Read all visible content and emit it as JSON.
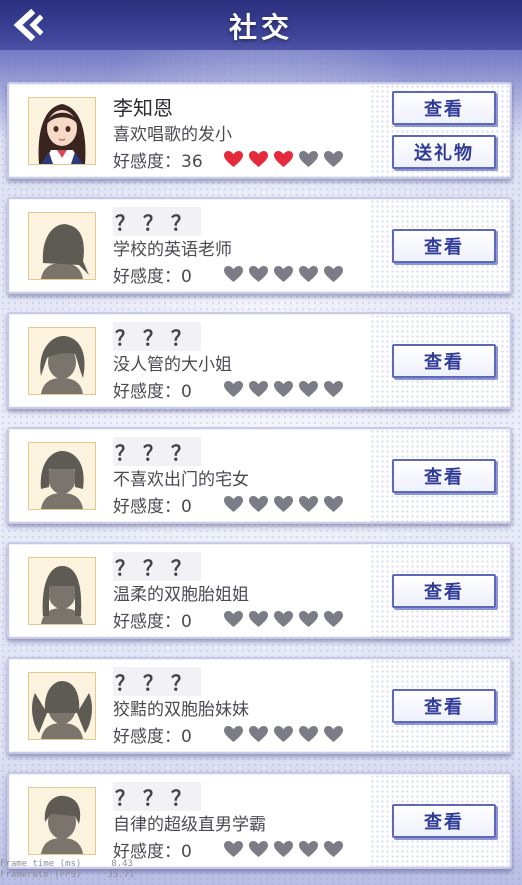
{
  "header": {
    "title": "社交",
    "back_icon": "back-arrow-icon"
  },
  "colors": {
    "heart_on": "#e52a3c",
    "heart_off": "#7c7c86",
    "button_border": "#5d68b8",
    "button_text": "#2f3b96"
  },
  "cards": [
    {
      "name": "李知恩",
      "desc": "喜欢唱歌的发小",
      "fav_label": "好感度：36",
      "hearts_filled": 3,
      "hearts_total": 5,
      "view_label": "查看",
      "gift_label": "送礼物",
      "avatar": "girl-portrait"
    },
    {
      "name": "？？？",
      "desc": "学校的英语老师",
      "fav_label": "好感度：0",
      "hearts_filled": 0,
      "hearts_total": 5,
      "view_label": "查看",
      "avatar": "silhouette-ponytail"
    },
    {
      "name": "？？？",
      "desc": "没人管的大小姐",
      "fav_label": "好感度：0",
      "hearts_filled": 0,
      "hearts_total": 5,
      "view_label": "查看",
      "avatar": "silhouette-short-wavy"
    },
    {
      "name": "？？？",
      "desc": "不喜欢出门的宅女",
      "fav_label": "好感度：0",
      "hearts_filled": 0,
      "hearts_total": 5,
      "view_label": "查看",
      "avatar": "silhouette-bob"
    },
    {
      "name": "？？？",
      "desc": "温柔的双胞胎姐姐",
      "fav_label": "好感度：0",
      "hearts_filled": 0,
      "hearts_total": 5,
      "view_label": "查看",
      "avatar": "silhouette-straight"
    },
    {
      "name": "？？？",
      "desc": "狡黠的双胞胎妹妹",
      "fav_label": "好感度：0",
      "hearts_filled": 0,
      "hearts_total": 5,
      "view_label": "查看",
      "avatar": "silhouette-twintails"
    },
    {
      "name": "？？？",
      "desc": "自律的超级直男学霸",
      "fav_label": "好感度：0",
      "hearts_filled": 0,
      "hearts_total": 5,
      "view_label": "查看",
      "avatar": "silhouette-boy"
    }
  ],
  "debug": {
    "frame_time_label": "Frame time (ms)",
    "frame_time_value": "8.43",
    "fps_label": "Framerate (FPS)",
    "fps_value": "35.71"
  }
}
